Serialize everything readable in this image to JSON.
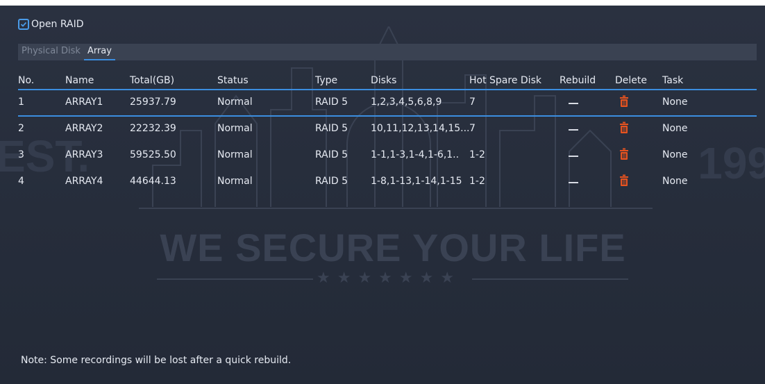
{
  "watermark": {
    "tagline": "WE SECURE YOUR LIFE",
    "stars": "★★★★★★★",
    "left_text": "EST.",
    "right_text": "199"
  },
  "open_raid": {
    "label": "Open RAID",
    "checked": true
  },
  "tabs": [
    {
      "label": "Physical Disk",
      "active": false
    },
    {
      "label": "Array",
      "active": true
    }
  ],
  "table": {
    "headers": [
      "No.",
      "Name",
      "Total(GB)",
      "Status",
      "Type",
      "Disks",
      "Hot Spare Disk",
      "Rebuild",
      "Delete",
      "Task"
    ],
    "rows": [
      {
        "no": "1",
        "name": "ARRAY1",
        "total": "25937.79",
        "status": "Normal",
        "type": "RAID 5",
        "disks": "1,2,3,4,5,6,8,9",
        "hot": "7",
        "task": "None",
        "selected": true
      },
      {
        "no": "2",
        "name": "ARRAY2",
        "total": "22232.39",
        "status": "Normal",
        "type": "RAID 5",
        "disks": "10,11,12,13,14,15...",
        "hot": "7",
        "task": "None"
      },
      {
        "no": "3",
        "name": "ARRAY3",
        "total": "59525.50",
        "status": "Normal",
        "type": "RAID 5",
        "disks": "1-1,1-3,1-4,1-6,1..",
        "hot": "1-2",
        "task": "None"
      },
      {
        "no": "4",
        "name": "ARRAY4",
        "total": "44644.13",
        "status": "Normal",
        "type": "RAID 5",
        "disks": "1-8,1-13,1-14,1-15",
        "hot": "1-2",
        "task": "None"
      }
    ],
    "rebuild_icon": "dash-icon",
    "delete_icon": "trash-icon"
  },
  "note": "Note: Some recordings will be lost after a quick rebuild.",
  "colors": {
    "accent": "#3b8ee0",
    "delete": "#e8531f",
    "background": "#262d3b"
  }
}
